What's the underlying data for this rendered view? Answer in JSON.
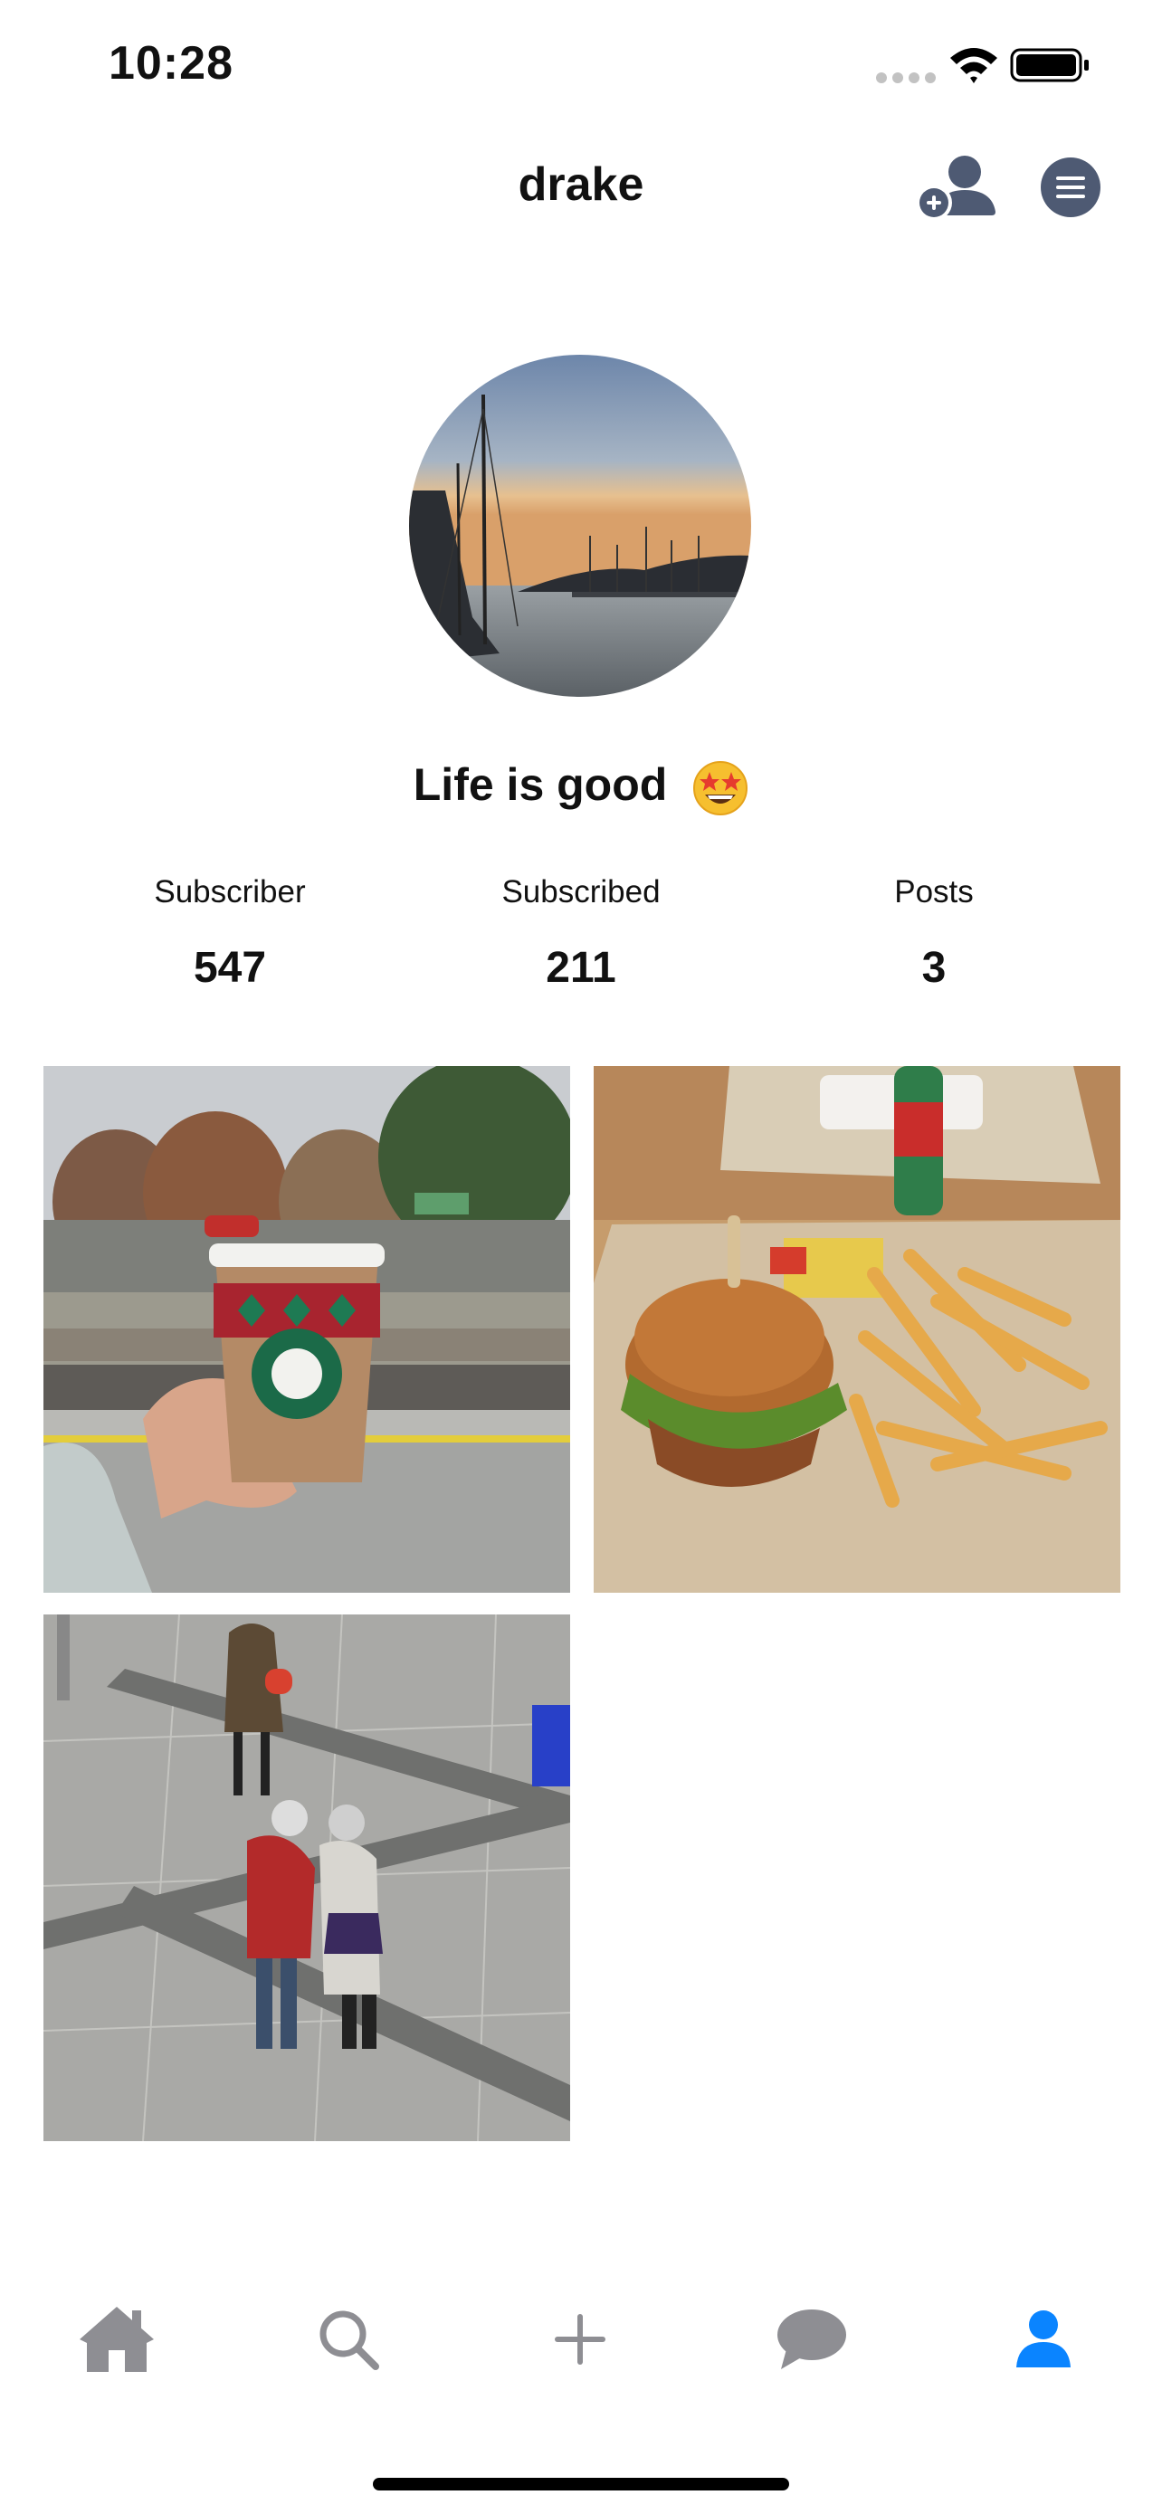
{
  "status_bar": {
    "time": "10:28"
  },
  "header": {
    "username": "drake"
  },
  "profile": {
    "bio": "Life is good",
    "bio_emoji": "star-struck-emoji"
  },
  "stats": [
    {
      "label": "Subscriber",
      "value": "547"
    },
    {
      "label": "Subscribed",
      "value": "211"
    },
    {
      "label": "Posts",
      "value": "3"
    }
  ],
  "posts": [
    {
      "subject": "coffee cup held at train platform"
    },
    {
      "subject": "burger and fries on tray"
    },
    {
      "subject": "two people hugging in station hall"
    }
  ],
  "tab_bar": {
    "items": [
      "home-icon",
      "search-icon",
      "plus-icon",
      "chat-bubble-icon",
      "profile-icon"
    ],
    "active": "profile-icon"
  },
  "colors": {
    "accent": "#0a84ff",
    "icon_inactive": "#8e8e93",
    "header_icon": "#4e5a73"
  }
}
